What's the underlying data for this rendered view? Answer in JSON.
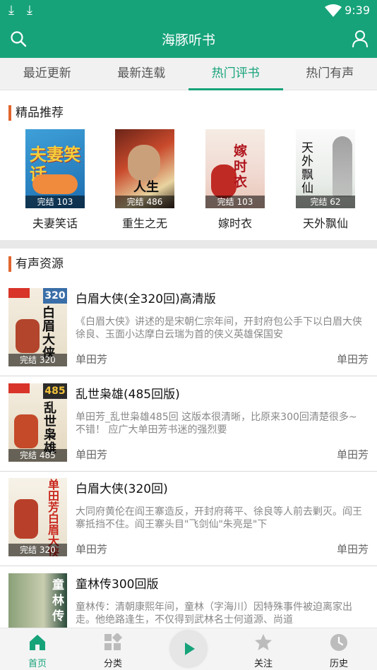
{
  "status": {
    "download1": "⤓",
    "download2": "⤓",
    "time": "9:39"
  },
  "header": {
    "title": "海豚听书"
  },
  "tabs": [
    "最近更新",
    "最新连载",
    "热门评书",
    "热门有声"
  ],
  "featured": {
    "title": "精品推荐",
    "items": [
      {
        "name": "夫妻笑话",
        "badge": "完结 103",
        "cover_text": "夫妻笑话"
      },
      {
        "name": "重生之无",
        "badge": "完结 486",
        "cover_text": "人生"
      },
      {
        "name": "嫁时衣",
        "badge": "完结 103",
        "cover_text": "嫁时衣"
      },
      {
        "name": "天外飘仙",
        "badge": "完结 62",
        "cover_text": "天外飘仙"
      }
    ]
  },
  "audio": {
    "title": "有声资源",
    "items": [
      {
        "title": "白眉大侠(全320回)高清版",
        "desc": "《白眉大侠》讲述的是宋朝仁宗年间，开封府包公手下以白眉大侠徐良、玉面小达摩白云瑞为首的侠义英雄保国安",
        "author": "单田芳",
        "author2": "单田芳",
        "badge": "完结 320",
        "cover_num": "320",
        "cover_text": "白眉大侠"
      },
      {
        "title": "乱世枭雄(485回版)",
        "desc": "单田芳_乱世枭雄485回 这版本很清晰，比原来300回清楚很多~不错！ 应广大单田芳书迷的强烈要",
        "author": "单田芳",
        "author2": "单田芳",
        "badge": "完结 485",
        "cover_num": "485",
        "cover_text": "乱世枭雄"
      },
      {
        "title": "白眉大侠(320回)",
        "desc": "大同府黄伦在阎王寨造反，开封府蒋平、徐良等人前去剿灭。阎王寨抵挡不住。阎王寨头目\"飞剑仙\"朱亮是\"下",
        "author": "单田芳",
        "author2": "单田芳",
        "badge": "完结 320",
        "cover_num": "",
        "cover_text": "单田芳白眉大侠"
      },
      {
        "title": "童林传300回版",
        "desc": "童林传：清朝康熙年间，童林（字海川）因特殊事件被迫离家出走。他绝路逢生，不仅得到武林名士何道源、尚道",
        "author": "",
        "author2": "",
        "badge": "",
        "cover_num": "",
        "cover_text": "童林传"
      }
    ]
  },
  "nav": [
    {
      "label": "首页",
      "icon": "home-icon"
    },
    {
      "label": "分类",
      "icon": "category-icon"
    },
    {
      "label": "",
      "icon": "play-icon"
    },
    {
      "label": "关注",
      "icon": "star-icon"
    },
    {
      "label": "历史",
      "icon": "clock-icon"
    }
  ],
  "colors": {
    "primary": "#17a37a",
    "accent": "#e0662e"
  }
}
